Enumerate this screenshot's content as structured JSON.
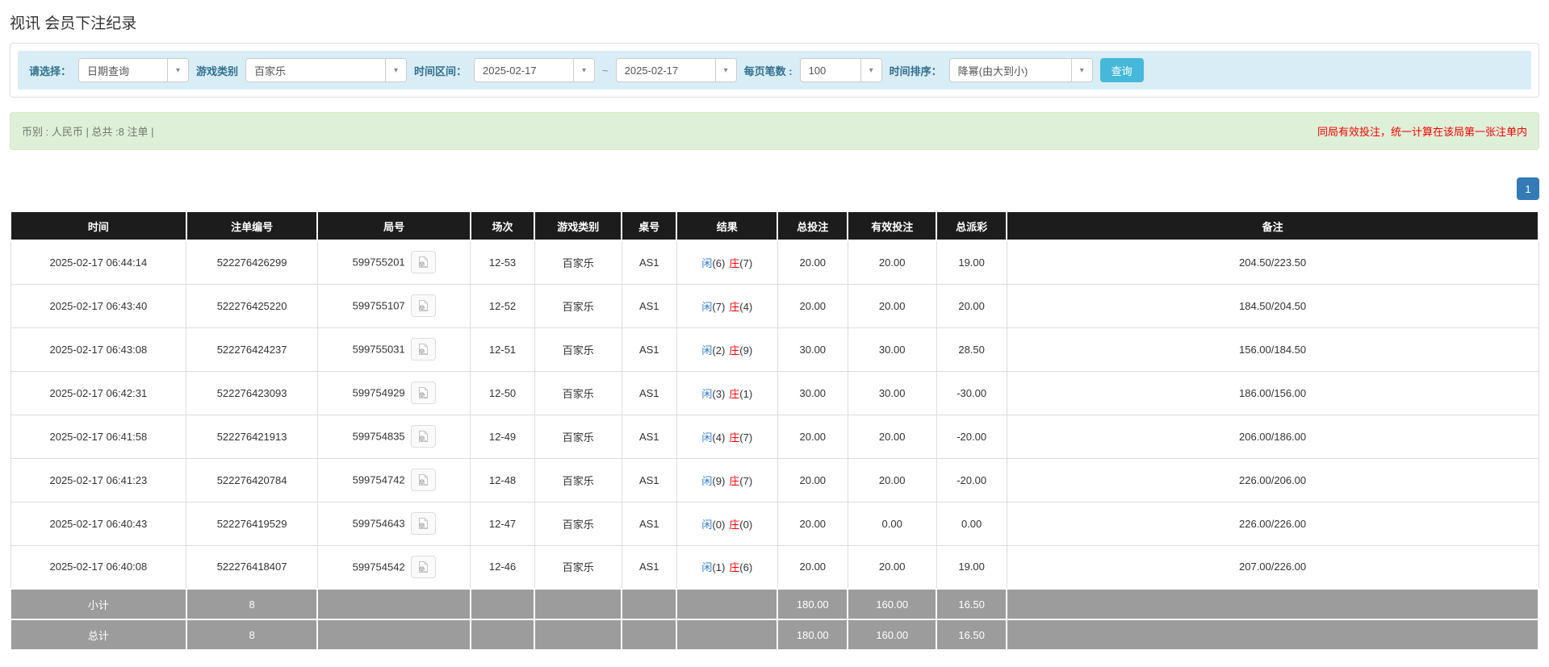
{
  "page": {
    "title": "视讯 会员下注纪录"
  },
  "colors": {
    "accent_blue": "#337ab7",
    "link_blue": "#2f7ed8",
    "negative_red": "#ff0000",
    "notice_red": "#ff0000",
    "label_blue": "#31708f",
    "button_blue": "#46b8da",
    "bar_bg": "#d9edf7",
    "summary_bg": "#dff0d8",
    "summary_text": "#6d7a6d",
    "header_bg": "#1c1c1c",
    "footer_bg": "#9c9c9c"
  },
  "filters": {
    "query_type_label": "请选择：",
    "query_type_value": "日期查询",
    "game_type_label": "游戏类别",
    "game_type_value": "百家乐",
    "time_range_label": "时间区间：",
    "date_from": "2025-02-17",
    "range_separator": "~",
    "date_to": "2025-02-17",
    "page_size_label": "每页笔数 :",
    "page_size_value": "100",
    "time_sort_label": "时间排序：",
    "time_sort_value": "降幂(由大到小)",
    "search_button": "查询",
    "caret_icon": "▾"
  },
  "summary": {
    "left_text": "币别 : 人民币 | 总共 :8 注单 |",
    "right_notice": "同局有效投注，统一计算在该局第一张注单内"
  },
  "pagination": {
    "current": "1"
  },
  "table": {
    "headers": [
      "时间",
      "注单编号",
      "局号",
      "场次",
      "游戏类别",
      "桌号",
      "结果",
      "总投注",
      "有效投注",
      "总派彩",
      "备注"
    ],
    "result_labels": {
      "player": "闲",
      "banker": "庄"
    },
    "rows": [
      {
        "time": "2025-02-17 06:44:14",
        "bet_no": "522276426299",
        "round_no": "599755201",
        "session": "12-53",
        "game": "百家乐",
        "table_no": "AS1",
        "player": "6",
        "banker": "7",
        "total_bet": "20.00",
        "valid_bet": "20.00",
        "payout": "19.00",
        "remark": "204.50/223.50"
      },
      {
        "time": "2025-02-17 06:43:40",
        "bet_no": "522276425220",
        "round_no": "599755107",
        "session": "12-52",
        "game": "百家乐",
        "table_no": "AS1",
        "player": "7",
        "banker": "4",
        "total_bet": "20.00",
        "valid_bet": "20.00",
        "payout": "20.00",
        "remark": "184.50/204.50"
      },
      {
        "time": "2025-02-17 06:43:08",
        "bet_no": "522276424237",
        "round_no": "599755031",
        "session": "12-51",
        "game": "百家乐",
        "table_no": "AS1",
        "player": "2",
        "banker": "9",
        "total_bet": "30.00",
        "valid_bet": "30.00",
        "payout": "28.50",
        "remark": "156.00/184.50"
      },
      {
        "time": "2025-02-17 06:42:31",
        "bet_no": "522276423093",
        "round_no": "599754929",
        "session": "12-50",
        "game": "百家乐",
        "table_no": "AS1",
        "player": "3",
        "banker": "1",
        "total_bet": "30.00",
        "valid_bet": "30.00",
        "payout": "-30.00",
        "remark": "186.00/156.00"
      },
      {
        "time": "2025-02-17 06:41:58",
        "bet_no": "522276421913",
        "round_no": "599754835",
        "session": "12-49",
        "game": "百家乐",
        "table_no": "AS1",
        "player": "4",
        "banker": "7",
        "total_bet": "20.00",
        "valid_bet": "20.00",
        "payout": "-20.00",
        "remark": "206.00/186.00"
      },
      {
        "time": "2025-02-17 06:41:23",
        "bet_no": "522276420784",
        "round_no": "599754742",
        "session": "12-48",
        "game": "百家乐",
        "table_no": "AS1",
        "player": "9",
        "banker": "7",
        "total_bet": "20.00",
        "valid_bet": "20.00",
        "payout": "-20.00",
        "remark": "226.00/206.00"
      },
      {
        "time": "2025-02-17 06:40:43",
        "bet_no": "522276419529",
        "round_no": "599754643",
        "session": "12-47",
        "game": "百家乐",
        "table_no": "AS1",
        "player": "0",
        "banker": "0",
        "total_bet": "20.00",
        "valid_bet": "0.00",
        "payout": "0.00",
        "remark": "226.00/226.00"
      },
      {
        "time": "2025-02-17 06:40:08",
        "bet_no": "522276418407",
        "round_no": "599754542",
        "session": "12-46",
        "game": "百家乐",
        "table_no": "AS1",
        "player": "1",
        "banker": "6",
        "total_bet": "20.00",
        "valid_bet": "20.00",
        "payout": "19.00",
        "remark": "207.00/226.00"
      }
    ],
    "subtotal": {
      "label": "小计",
      "count": "8",
      "total_bet": "180.00",
      "valid_bet": "160.00",
      "payout": "16.50"
    },
    "total": {
      "label": "总计",
      "count": "8",
      "total_bet": "180.00",
      "valid_bet": "160.00",
      "payout": "16.50"
    }
  }
}
